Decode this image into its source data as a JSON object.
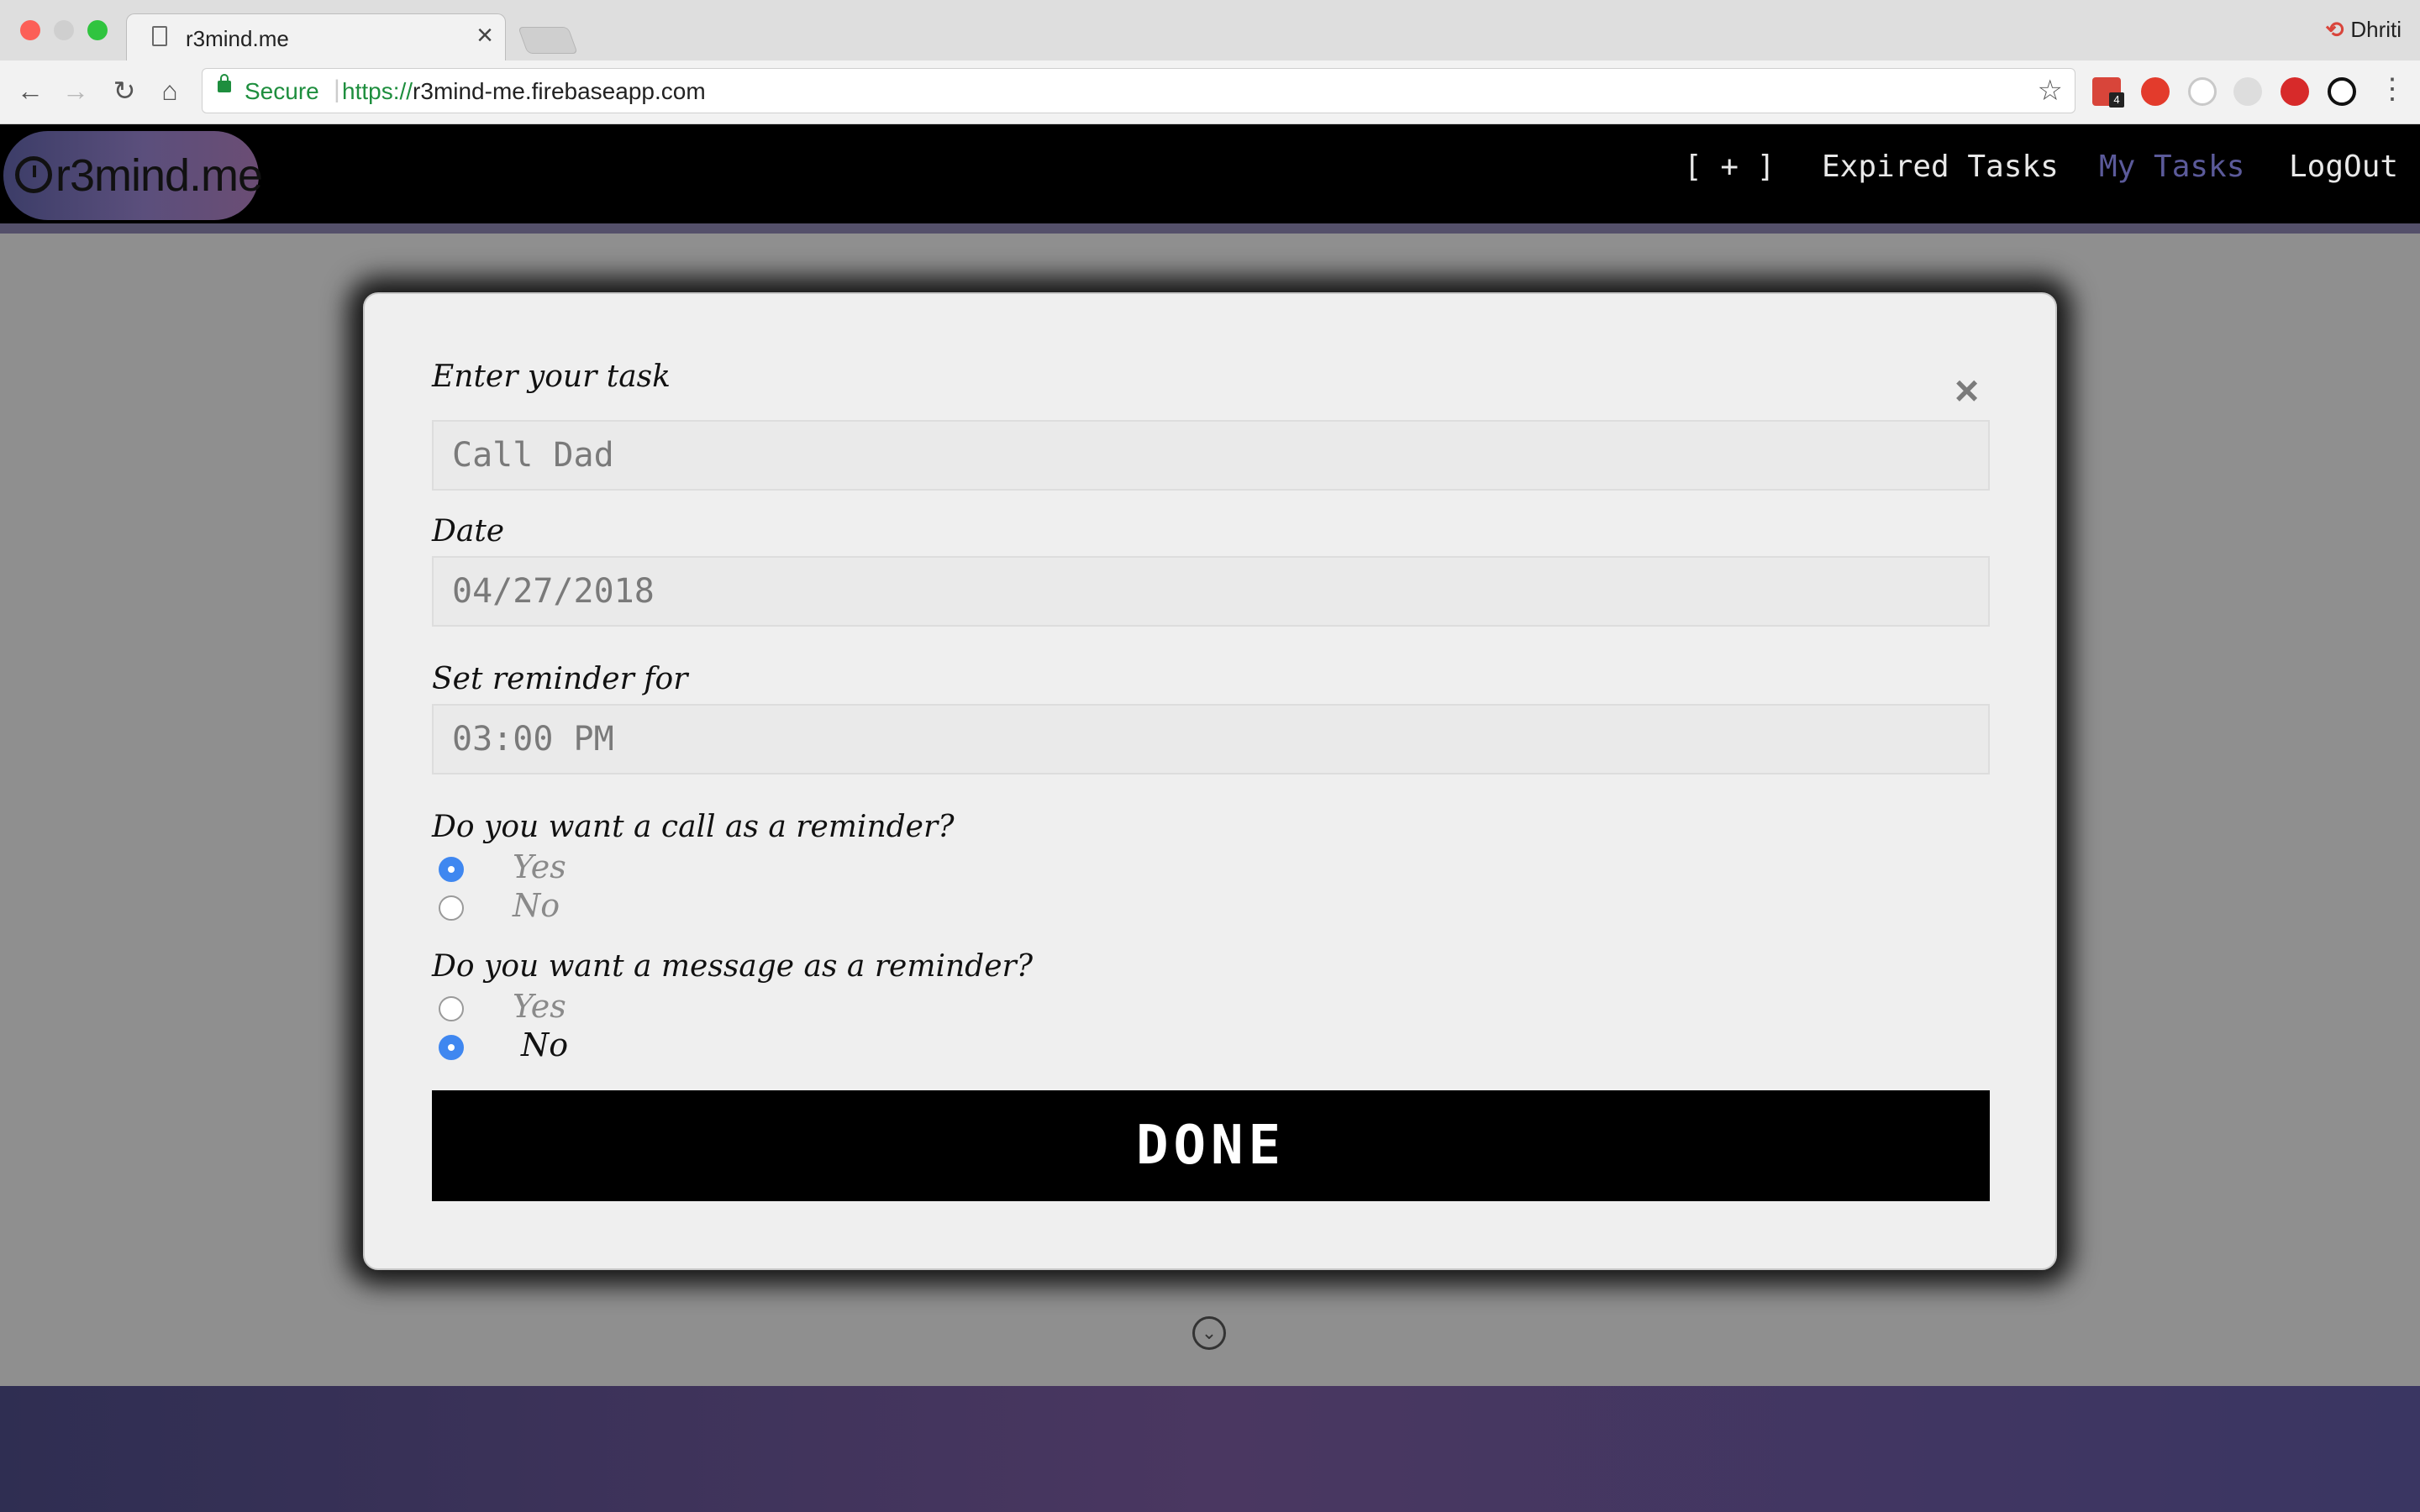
{
  "browser": {
    "tab_title": "r3mind.me",
    "tab_close": "×",
    "profile_name": "Dhriti",
    "security_label": "Secure",
    "url_scheme": "https://",
    "url_host": "r3mind-me.firebaseapp.com",
    "nav": {
      "back": "←",
      "forward": "→",
      "reload": "↻",
      "home": "⌂"
    },
    "extension_badge": "4",
    "menu": "⋮"
  },
  "app_nav": {
    "logo_text": "r3mind.me",
    "links": [
      {
        "label": "[ + ]",
        "active": false
      },
      {
        "label": "Expired Tasks",
        "active": false
      },
      {
        "label": "My Tasks",
        "active": true
      },
      {
        "label": "LogOut",
        "active": false
      }
    ],
    "active_color": "#5b5a9a"
  },
  "modal": {
    "close_symbol": "×",
    "task": {
      "label": "Enter your task",
      "value": "Call Dad"
    },
    "date": {
      "label": "Date",
      "value": "04/27/2018"
    },
    "reminder": {
      "label": "Set reminder for",
      "value": "03:00 PM"
    },
    "call_question": {
      "label": "Do you want a call as a reminder?",
      "options": [
        {
          "label": "Yes",
          "checked": true
        },
        {
          "label": "No",
          "checked": false
        }
      ]
    },
    "message_question": {
      "label": "Do you want a message as a reminder?",
      "options": [
        {
          "label": "Yes",
          "checked": false
        },
        {
          "label": "No",
          "checked": true
        }
      ]
    },
    "done_label": "DONE"
  },
  "scroll_symbol": "⌄",
  "colors": {
    "radio_checked": "#3f87f0",
    "accent_band": "#54506a"
  }
}
